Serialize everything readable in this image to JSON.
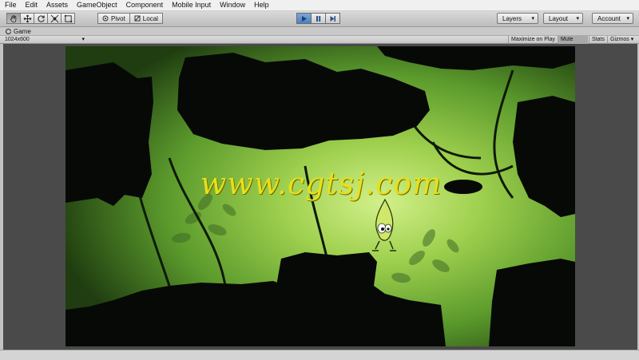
{
  "menu": [
    "File",
    "Edit",
    "Assets",
    "GameObject",
    "Component",
    "Mobile Input",
    "Window",
    "Help"
  ],
  "toolbar": {
    "tools": [
      "hand-icon",
      "move-icon",
      "rotate-icon",
      "scale-icon",
      "rect-tool-icon"
    ],
    "pivot_label": "Pivot",
    "local_label": "Local",
    "play_controls": [
      "play-icon",
      "pause-icon",
      "step-icon"
    ],
    "layers_label": "Layers",
    "layout_label": "Layout",
    "account_label": "Account"
  },
  "game_tab": {
    "label": "Game",
    "aspect": "1024x600",
    "maximize_label": "Maximize on Play",
    "mute_label": "Mute audio",
    "stats_label": "Stats",
    "gizmos_label": "Gizmos"
  },
  "scene": {
    "watermark": "www.cgtsj.com"
  },
  "colors": {
    "accent_play": "#4d7fc2",
    "scene_glow": "#b7e26a",
    "watermark": "#e8e01a"
  }
}
